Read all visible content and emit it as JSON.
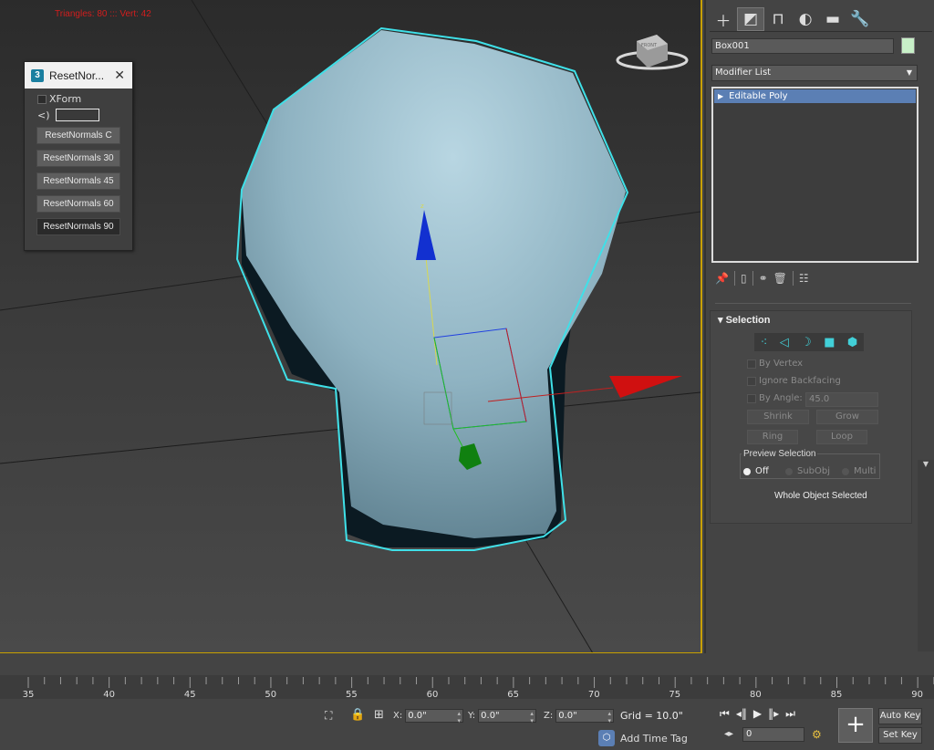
{
  "viewport": {
    "stats": "Triangles: 80 ::: Vert: 42",
    "gizmo_axis_label": "z",
    "viewcube_label": "FRONT"
  },
  "dialog": {
    "title": "ResetNor...",
    "close": "✕",
    "xform_label": "XForm",
    "spinner_label": "<)",
    "buttons": [
      "ResetNormals C",
      "ResetNormals 30",
      "ResetNormals 45",
      "ResetNormals 60",
      "ResetNormals 90"
    ]
  },
  "panel": {
    "tabs": [
      "create-icon",
      "modify-icon",
      "hierarchy-icon",
      "motion-icon",
      "display-icon",
      "utilities-icon"
    ],
    "object_name": "Box001",
    "object_color": "#c8f0c8",
    "modifier_list": "Modifier List",
    "stack_items": [
      "Editable Poly"
    ],
    "selection": {
      "title": "Selection",
      "by_vertex": "By Vertex",
      "ignore_backfacing": "Ignore Backfacing",
      "by_angle": "By Angle:",
      "angle_value": "45.0",
      "shrink": "Shrink",
      "grow": "Grow",
      "ring": "Ring",
      "loop": "Loop",
      "preview_selection": "Preview Selection",
      "off": "Off",
      "subobj": "SubObj",
      "multi": "Multi",
      "status": "Whole Object Selected"
    }
  },
  "timeline": {
    "ticks": [
      "35",
      "40",
      "45",
      "50",
      "55",
      "60",
      "65",
      "70",
      "75",
      "80",
      "85",
      "90"
    ]
  },
  "status": {
    "x_label": "X:",
    "x_value": "0.0\"",
    "y_label": "Y:",
    "y_value": "0.0\"",
    "z_label": "Z:",
    "z_value": "0.0\"",
    "grid": "Grid = 10.0\"",
    "add_time_tag": "Add Time Tag",
    "frame": "0",
    "auto_key": "Auto Key",
    "set_key": "Set Key"
  },
  "colors": {
    "accent_selection": "#5b7fb4",
    "viewport_border": "#c8a000",
    "outline": "#3fe0e8"
  }
}
